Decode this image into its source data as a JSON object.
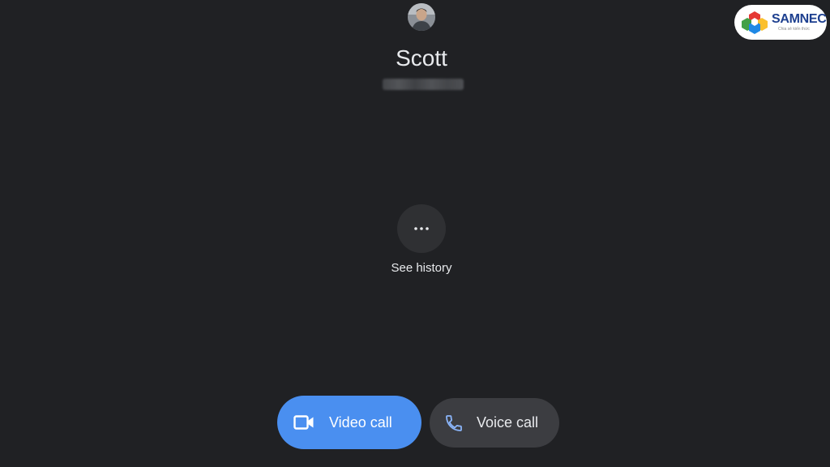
{
  "contact": {
    "name": "Scott",
    "number": "(blurred phone number)"
  },
  "history": {
    "icon": "more-horizontal-icon",
    "label": "See history"
  },
  "actions": {
    "video_call": {
      "label": "Video call",
      "icon": "videocam-icon",
      "color": "#4a8ff0"
    },
    "voice_call": {
      "label": "Voice call",
      "icon": "phone-icon",
      "color": "#3c3d41"
    }
  },
  "watermark": {
    "brand": "SAMNEC",
    "tagline": "Chia sẻ kiến thức"
  },
  "colors": {
    "background": "#202124",
    "accent": "#4a8ff0"
  }
}
